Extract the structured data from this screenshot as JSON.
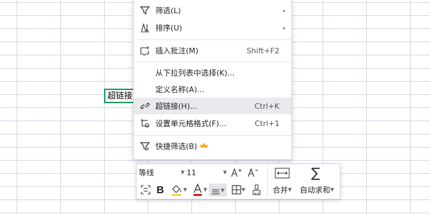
{
  "sheet": {
    "active_cell_text": "超链接"
  },
  "context_menu": {
    "items": [
      {
        "label": "筛选(L)",
        "shortcut": "",
        "icon": "filter-icon",
        "submenu": true
      },
      {
        "label": "排序(U)",
        "shortcut": "",
        "icon": "sort-icon",
        "submenu": true
      },
      {
        "label": "插入批注(M)",
        "shortcut": "Shift+F2",
        "icon": "insert-comment-icon",
        "submenu": false
      },
      {
        "label": "从下拉列表中选择(K)...",
        "shortcut": "",
        "icon": "",
        "submenu": false
      },
      {
        "label": "定义名称(A)...",
        "shortcut": "",
        "icon": "",
        "submenu": false
      },
      {
        "label": "超链接(H)...",
        "shortcut": "Ctrl+K",
        "icon": "hyperlink-icon",
        "submenu": false,
        "highlighted": true
      },
      {
        "label": "设置单元格格式(F)...",
        "shortcut": "Ctrl+1",
        "icon": "format-cells-icon",
        "submenu": false
      },
      {
        "label": "快捷筛选(B)",
        "shortcut": "",
        "icon": "quick-filter-icon",
        "submenu": false,
        "badge": "crown-icon"
      }
    ],
    "colors": {
      "highlight": "#e8eaee",
      "crown": "#f5a623"
    }
  },
  "mini_toolbar": {
    "font_name": "等线",
    "font_size": "11",
    "merge_label": "合并",
    "autosum_label": "自动求和",
    "colors": {
      "font_color": "#e02020",
      "fill_color": "#f5d742"
    }
  }
}
